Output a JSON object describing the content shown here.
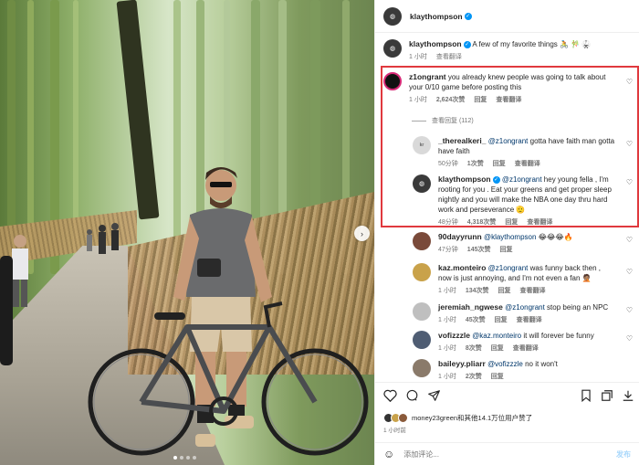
{
  "post": {
    "author": "klaythompson",
    "caption": "A few of my favorite things 🚴 🎋 🥋",
    "caption_time": "1 小时",
    "caption_translate": "查看翻译"
  },
  "comments": [
    {
      "user": "z1ongrant",
      "verified": false,
      "mention": "",
      "text": "you already knew people was going to talk about your 0/10 game before posting this",
      "time": "1 小时",
      "likes": "2,624次赞",
      "reply": "回复",
      "translate": "查看翻译",
      "avatar_color": "#111111"
    },
    {
      "user": "_therealkeri_",
      "verified": false,
      "mention": "@z1ongrant",
      "text": "gotta have faith man gotta have faith",
      "time": "50分钟",
      "likes": "1次赞",
      "reply": "回复",
      "translate": "查看翻译",
      "avatar_color": "#d9d9d9"
    },
    {
      "user": "klaythompson",
      "verified": true,
      "mention": "@z1ongrant",
      "text": "hey young fella , I'm rooting for you . Eat your greens and get proper sleep nightly and you will make the NBA one day thru hard work and perseverance 🫡",
      "time": "48分钟",
      "likes": "4,318次赞",
      "reply": "回复",
      "translate": "查看翻译",
      "avatar_color": "#3a3a3a"
    },
    {
      "user": "90dayyrunn",
      "verified": false,
      "mention": "@klaythompson",
      "text": "😂😂😂🔥",
      "time": "47分钟",
      "likes": "145次赞",
      "reply": "回复",
      "translate": "",
      "avatar_color": "#7a4a3a"
    },
    {
      "user": "kaz.monteiro",
      "verified": false,
      "mention": "@z1ongrant",
      "text": "was funny back then , now is just annoying, and I'm not even a fan 🤦🏽",
      "time": "1 小时",
      "likes": "134次赞",
      "reply": "回复",
      "translate": "查看翻译",
      "avatar_color": "#c9a24a"
    },
    {
      "user": "jeremiah_ngwese",
      "verified": false,
      "mention": "@z1ongrant",
      "text": "stop being an NPC",
      "time": "1 小时",
      "likes": "45次赞",
      "reply": "回复",
      "translate": "查看翻译",
      "avatar_color": "#bfbfbf"
    },
    {
      "user": "vofizzzle",
      "verified": false,
      "mention": "@kaz.monteiro",
      "text": "it will forever be funny",
      "time": "1 小时",
      "likes": "8次赞",
      "reply": "回复",
      "translate": "查看翻译",
      "avatar_color": "#4f5d73"
    },
    {
      "user": "baileyy.pliarr",
      "verified": false,
      "mention": "@vofizzzle",
      "text": "no it won't",
      "time": "1 小时",
      "likes": "2次赞",
      "reply": "回复",
      "translate": "",
      "avatar_color": "#8a7a6a"
    }
  ],
  "view_replies": "查看回复 (112)",
  "likes_line": "money23green和其他14.1万位用户赞了",
  "post_time": "1 小时前",
  "composer": {
    "placeholder": "添加评论...",
    "post": "发布"
  },
  "colors": {
    "highlight": "#e0393e",
    "link": "#00376b",
    "verified": "#0095f6"
  }
}
